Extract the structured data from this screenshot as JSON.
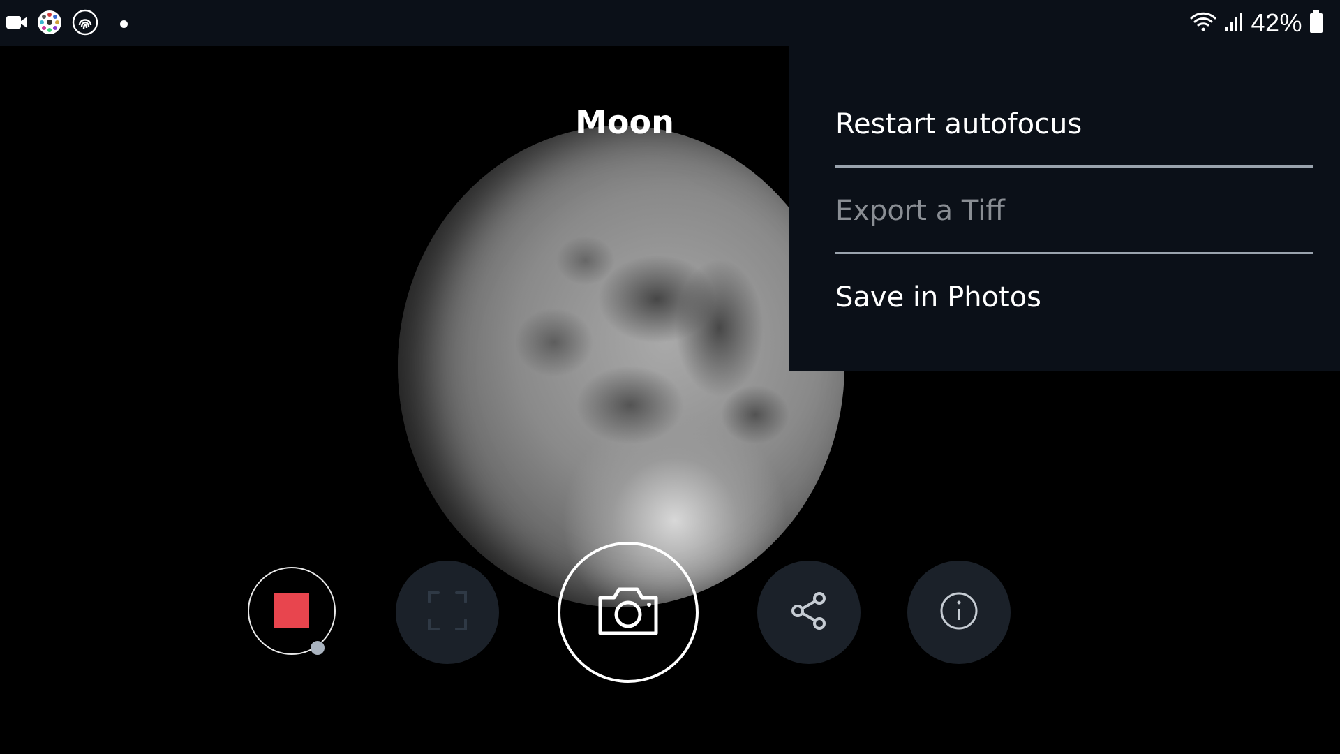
{
  "status_bar": {
    "left_icons": [
      "video-camera-icon",
      "dotted-circle-app-icon",
      "fingerprint-app-icon",
      "notification-dot-icon"
    ],
    "right_icons": [
      "wifi-icon",
      "cellular-signal-icon",
      "battery-icon"
    ],
    "battery_percent": "42%"
  },
  "viewer": {
    "title": "Moon"
  },
  "menu": {
    "items": [
      {
        "label": "Restart autofocus",
        "enabled": true
      },
      {
        "label": "Export a Tiff",
        "enabled": false
      },
      {
        "label": "Save in Photos",
        "enabled": true
      }
    ]
  },
  "controls": {
    "buttons": [
      {
        "name": "stop-recording-button",
        "icon": "stop-square-icon"
      },
      {
        "name": "frame-button",
        "icon": "frame-corners-icon"
      },
      {
        "name": "capture-button",
        "icon": "camera-icon"
      },
      {
        "name": "share-button",
        "icon": "share-icon"
      },
      {
        "name": "info-button",
        "icon": "info-icon"
      }
    ],
    "accent_color": "#e8454e"
  }
}
